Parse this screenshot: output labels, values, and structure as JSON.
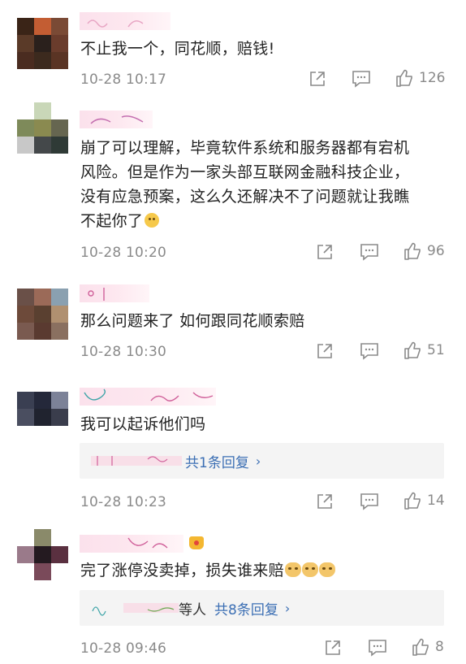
{
  "comments": [
    {
      "text": "不止我一个，同花顺，赔钱!",
      "time": "10-28 10:17",
      "likes": "126",
      "avatar_colors": [
        "#3a2417",
        "#c35d33",
        "#7a4a35",
        "#5a3a28",
        "#2a201c",
        "#6a3c2c",
        "#4a2c20",
        "#3c2a1e",
        "#5a3424"
      ]
    },
    {
      "text_lines": [
        "崩了可以理解，毕竟软件系统和服务器都有宕机",
        "风险。但是作为一家头部互联网金融科技企业，",
        "没有应急预案，这么久还解决不了问题就让我瞧",
        "不起你了"
      ],
      "time": "10-28 10:20",
      "likes": "96",
      "avatar_colors": [
        "#ffffff",
        "#c9d7b8",
        "#ffffff",
        "#7e8a5a",
        "#8a8a50",
        "#666650",
        "#c8c8c8",
        "#44484a",
        "#2f3a36"
      ]
    },
    {
      "text": "那么问题来了 如何跟同花顺索赔",
      "time": "10-28 10:30",
      "likes": "51",
      "avatar_colors": [
        "#6a5048",
        "#9b6a58",
        "#8aa0b0",
        "#6d4a3a",
        "#5a4030",
        "#b09070",
        "#7a5a50",
        "#5a3a30",
        "#8a7060"
      ]
    },
    {
      "text": "我可以起诉他们吗",
      "time": "10-28 10:23",
      "likes": "14",
      "reply_summary": "共1条回复",
      "reply_chevron": "›",
      "avatar_colors": [
        "#3a3f52",
        "#24283a",
        "#7c8298",
        "#4a4e60",
        "#20232f",
        "#3a3d4c",
        "#ffffff",
        "#ffffff",
        "#ffffff"
      ]
    },
    {
      "text": "完了涨停没卖掉，损失谁来赔",
      "time": "10-28 09:46",
      "likes": "8",
      "reply_prefix": "等人",
      "reply_summary": "共8条回复",
      "reply_chevron": "›",
      "avatar_colors": [
        "#ffffff",
        "#8a8a6a",
        "#ffffff",
        "#9a7a8a",
        "#241a20",
        "#5a3040",
        "#ffffff",
        "#7a4a5a",
        "#ffffff"
      ]
    }
  ],
  "icons": {
    "share": "share-icon",
    "comment": "comment-icon",
    "like": "thumbs-up-icon"
  }
}
